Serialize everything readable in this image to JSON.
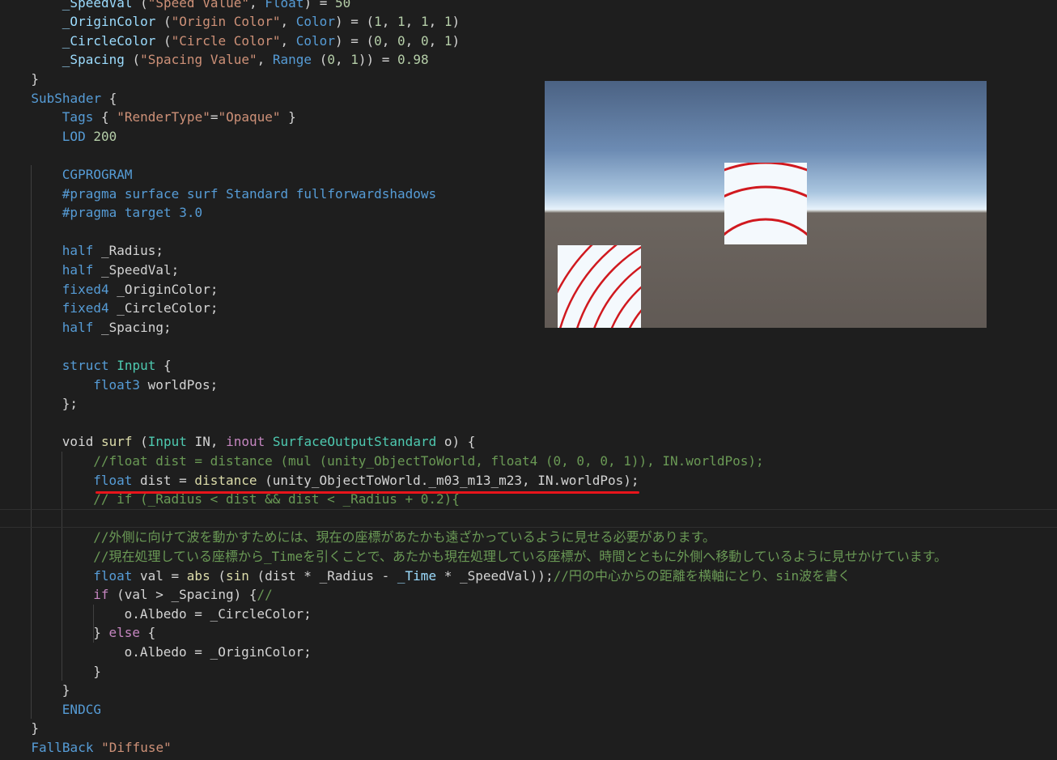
{
  "editor": {
    "lines": [
      {
        "indent": 2,
        "tokens": [
          [
            "var",
            "_SpeedVal"
          ],
          [
            "pl",
            " ("
          ],
          [
            "str",
            "\"Speed Value\""
          ],
          [
            "pl",
            ", "
          ],
          [
            "kw",
            "Float"
          ],
          [
            "pl",
            ") = "
          ],
          [
            "num",
            "50"
          ]
        ]
      },
      {
        "indent": 2,
        "tokens": [
          [
            "var",
            "_OriginColor"
          ],
          [
            "pl",
            " ("
          ],
          [
            "str",
            "\"Origin Color\""
          ],
          [
            "pl",
            ", "
          ],
          [
            "kw",
            "Color"
          ],
          [
            "pl",
            ") = ("
          ],
          [
            "num",
            "1"
          ],
          [
            "pl",
            ", "
          ],
          [
            "num",
            "1"
          ],
          [
            "pl",
            ", "
          ],
          [
            "num",
            "1"
          ],
          [
            "pl",
            ", "
          ],
          [
            "num",
            "1"
          ],
          [
            "pl",
            ")"
          ]
        ]
      },
      {
        "indent": 2,
        "tokens": [
          [
            "var",
            "_CircleColor"
          ],
          [
            "pl",
            " ("
          ],
          [
            "str",
            "\"Circle Color\""
          ],
          [
            "pl",
            ", "
          ],
          [
            "kw",
            "Color"
          ],
          [
            "pl",
            ") = ("
          ],
          [
            "num",
            "0"
          ],
          [
            "pl",
            ", "
          ],
          [
            "num",
            "0"
          ],
          [
            "pl",
            ", "
          ],
          [
            "num",
            "0"
          ],
          [
            "pl",
            ", "
          ],
          [
            "num",
            "1"
          ],
          [
            "pl",
            ")"
          ]
        ]
      },
      {
        "indent": 2,
        "tokens": [
          [
            "var",
            "_Spacing"
          ],
          [
            "pl",
            " ("
          ],
          [
            "str",
            "\"Spacing Value\""
          ],
          [
            "pl",
            ", "
          ],
          [
            "kw",
            "Range"
          ],
          [
            "pl",
            " ("
          ],
          [
            "num",
            "0"
          ],
          [
            "pl",
            ", "
          ],
          [
            "num",
            "1"
          ],
          [
            "pl",
            ")) = "
          ],
          [
            "num",
            "0.98"
          ]
        ]
      },
      {
        "indent": 1,
        "tokens": [
          [
            "pl",
            "}"
          ]
        ]
      },
      {
        "indent": 1,
        "tokens": [
          [
            "kw",
            "SubShader"
          ],
          [
            "pl",
            " {"
          ]
        ]
      },
      {
        "indent": 2,
        "tokens": [
          [
            "kw",
            "Tags"
          ],
          [
            "pl",
            " { "
          ],
          [
            "str",
            "\"RenderType\""
          ],
          [
            "pl",
            "="
          ],
          [
            "str",
            "\"Opaque\""
          ],
          [
            "pl",
            " }"
          ]
        ]
      },
      {
        "indent": 2,
        "tokens": [
          [
            "kw",
            "LOD"
          ],
          [
            "pl",
            " "
          ],
          [
            "num",
            "200"
          ]
        ]
      },
      {
        "indent": 0,
        "tokens": []
      },
      {
        "indent": 2,
        "tokens": [
          [
            "pp",
            "CGPROGRAM"
          ]
        ]
      },
      {
        "indent": 2,
        "tokens": [
          [
            "pp",
            "#pragma surface surf Standard fullforwardshadows"
          ]
        ]
      },
      {
        "indent": 2,
        "tokens": [
          [
            "pp",
            "#pragma target 3.0"
          ]
        ]
      },
      {
        "indent": 0,
        "tokens": []
      },
      {
        "indent": 2,
        "tokens": [
          [
            "kw",
            "half"
          ],
          [
            "pl",
            " _Radius;"
          ]
        ]
      },
      {
        "indent": 2,
        "tokens": [
          [
            "kw",
            "half"
          ],
          [
            "pl",
            " _SpeedVal;"
          ]
        ]
      },
      {
        "indent": 2,
        "tokens": [
          [
            "kw",
            "fixed4"
          ],
          [
            "pl",
            " _OriginColor;"
          ]
        ]
      },
      {
        "indent": 2,
        "tokens": [
          [
            "kw",
            "fixed4"
          ],
          [
            "pl",
            " _CircleColor;"
          ]
        ]
      },
      {
        "indent": 2,
        "tokens": [
          [
            "kw",
            "half"
          ],
          [
            "pl",
            " _Spacing;"
          ]
        ]
      },
      {
        "indent": 0,
        "tokens": []
      },
      {
        "indent": 2,
        "tokens": [
          [
            "kw",
            "struct"
          ],
          [
            "pl",
            " "
          ],
          [
            "ty",
            "Input"
          ],
          [
            "pl",
            " {"
          ]
        ]
      },
      {
        "indent": 3,
        "tokens": [
          [
            "kw",
            "float3"
          ],
          [
            "pl",
            " worldPos;"
          ]
        ]
      },
      {
        "indent": 2,
        "tokens": [
          [
            "pl",
            "};"
          ]
        ]
      },
      {
        "indent": 0,
        "tokens": []
      },
      {
        "indent": 2,
        "tokens": [
          [
            "pl",
            "void "
          ],
          [
            "fn",
            "surf"
          ],
          [
            "pl",
            " ("
          ],
          [
            "ty",
            "Input"
          ],
          [
            "pl",
            " IN, "
          ],
          [
            "ctl",
            "inout"
          ],
          [
            "pl",
            " "
          ],
          [
            "ty",
            "SurfaceOutputStandard"
          ],
          [
            "pl",
            " o) {"
          ]
        ]
      },
      {
        "indent": 3,
        "tokens": [
          [
            "cm",
            "//float dist = distance (mul (unity_ObjectToWorld, float4 (0, 0, 0, 1)), IN.worldPos);"
          ]
        ]
      },
      {
        "indent": 3,
        "tokens": [
          [
            "kw",
            "float"
          ],
          [
            "pl",
            " dist = "
          ],
          [
            "fn",
            "distance"
          ],
          [
            "pl",
            " (unity_ObjectToWorld._m03_m13_m23, IN.worldPos);"
          ]
        ]
      },
      {
        "indent": 3,
        "tokens": [
          [
            "cm",
            "// if (_Radius < dist && dist < _Radius + 0.2){"
          ]
        ]
      },
      {
        "indent": 0,
        "tokens": [],
        "active": true
      },
      {
        "indent": 3,
        "tokens": [
          [
            "cm",
            "//外側に向けて波を動かすためには、現在の座標があたかも遠ざかっているように見せる必要があります。"
          ]
        ]
      },
      {
        "indent": 3,
        "tokens": [
          [
            "cm",
            "//現在処理している座標から_Timeを引くことで、あたかも現在処理している座標が、時間とともに外側へ移動しているように見せかけています。"
          ]
        ]
      },
      {
        "indent": 3,
        "tokens": [
          [
            "kw",
            "float"
          ],
          [
            "pl",
            " val = "
          ],
          [
            "fn",
            "abs"
          ],
          [
            "pl",
            " ("
          ],
          [
            "fn",
            "sin"
          ],
          [
            "pl",
            " (dist * _Radius - "
          ],
          [
            "var",
            "_Time"
          ],
          [
            "pl",
            " * _SpeedVal));"
          ],
          [
            "cm",
            "//円の中心からの距離を横軸にとり、sin波を書く"
          ]
        ]
      },
      {
        "indent": 3,
        "tokens": [
          [
            "ctl",
            "if"
          ],
          [
            "pl",
            " (val > _Spacing) {"
          ],
          [
            "cm",
            "//"
          ]
        ]
      },
      {
        "indent": 4,
        "tokens": [
          [
            "pl",
            "o.Albedo = _CircleColor;"
          ]
        ]
      },
      {
        "indent": 3,
        "tokens": [
          [
            "pl",
            "} "
          ],
          [
            "ctl",
            "else"
          ],
          [
            "pl",
            " {"
          ]
        ]
      },
      {
        "indent": 4,
        "tokens": [
          [
            "pl",
            "o.Albedo = _OriginColor;"
          ]
        ]
      },
      {
        "indent": 3,
        "tokens": [
          [
            "pl",
            "}"
          ]
        ]
      },
      {
        "indent": 2,
        "tokens": [
          [
            "pl",
            "}"
          ]
        ]
      },
      {
        "indent": 2,
        "tokens": [
          [
            "pp",
            "ENDCG"
          ]
        ]
      },
      {
        "indent": 1,
        "tokens": [
          [
            "pl",
            "}"
          ]
        ]
      },
      {
        "indent": 1,
        "tokens": [
          [
            "kw",
            "FallBack"
          ],
          [
            "pl",
            " "
          ],
          [
            "str",
            "\"Diffuse\""
          ]
        ]
      }
    ]
  },
  "annotation": {
    "color": "#e8151b"
  },
  "preview": {
    "sky_color": "#6c8bb3",
    "ground_color": "#625b56",
    "quad_color": "#f4f9fd",
    "ring_color": "#d0191f"
  }
}
